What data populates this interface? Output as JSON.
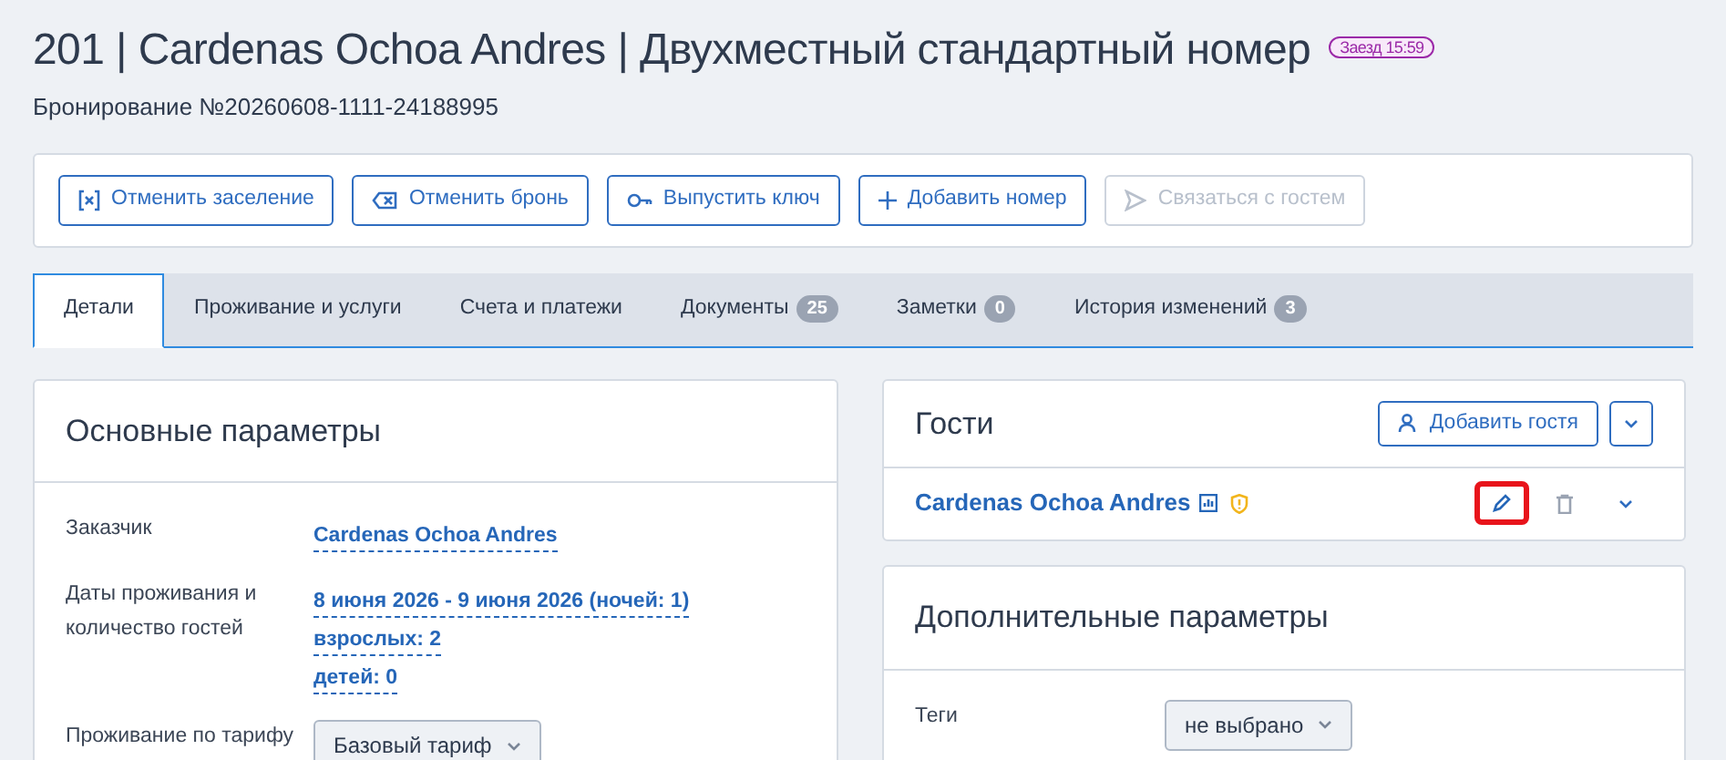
{
  "header": {
    "title": "201 | Cardenas Ochoa Andres | Двухместный стандартный номер",
    "badge": "Заезд 15:59",
    "subtitle": "Бронирование №20260608-1111-24188995"
  },
  "actions": [
    {
      "label": "Отменить заселение",
      "disabled": false
    },
    {
      "label": "Отменить бронь",
      "disabled": false
    },
    {
      "label": "Выпустить ключ",
      "disabled": false
    },
    {
      "label": "Добавить номер",
      "disabled": false
    },
    {
      "label": "Связаться с гостем",
      "disabled": true
    }
  ],
  "tabs": [
    {
      "label": "Детали",
      "selected": true
    },
    {
      "label": "Проживание и услуги",
      "selected": false
    },
    {
      "label": "Счета и платежи",
      "selected": false
    },
    {
      "label": "Документы",
      "count": "25",
      "selected": false
    },
    {
      "label": "Заметки",
      "count": "0",
      "selected": false
    },
    {
      "label": "История изменений",
      "count": "3",
      "selected": false
    }
  ],
  "main_params": {
    "title": "Основные параметры",
    "rows": [
      {
        "label": "Заказчик",
        "kind": "links",
        "values": [
          "Cardenas Ochoa Andres"
        ]
      },
      {
        "label": "Даты проживания и количество гостей",
        "kind": "links",
        "values": [
          "8 июня 2026 - 9 июня 2026 (ночей: 1)",
          "взрослых: 2",
          "детей: 0"
        ]
      },
      {
        "label": "Проживание по тарифу",
        "kind": "select",
        "values": [
          "Базовый тариф"
        ]
      }
    ]
  },
  "guests": {
    "title": "Гости",
    "add_button": "Добавить гостя",
    "items": [
      {
        "name": "Cardenas Ochoa Andres",
        "edit_highlighted": true
      }
    ]
  },
  "extra_params": {
    "title": "Дополнительные параметры",
    "rows": [
      {
        "label": "Теги",
        "kind": "select",
        "values": [
          "не выбрано"
        ]
      }
    ]
  }
}
